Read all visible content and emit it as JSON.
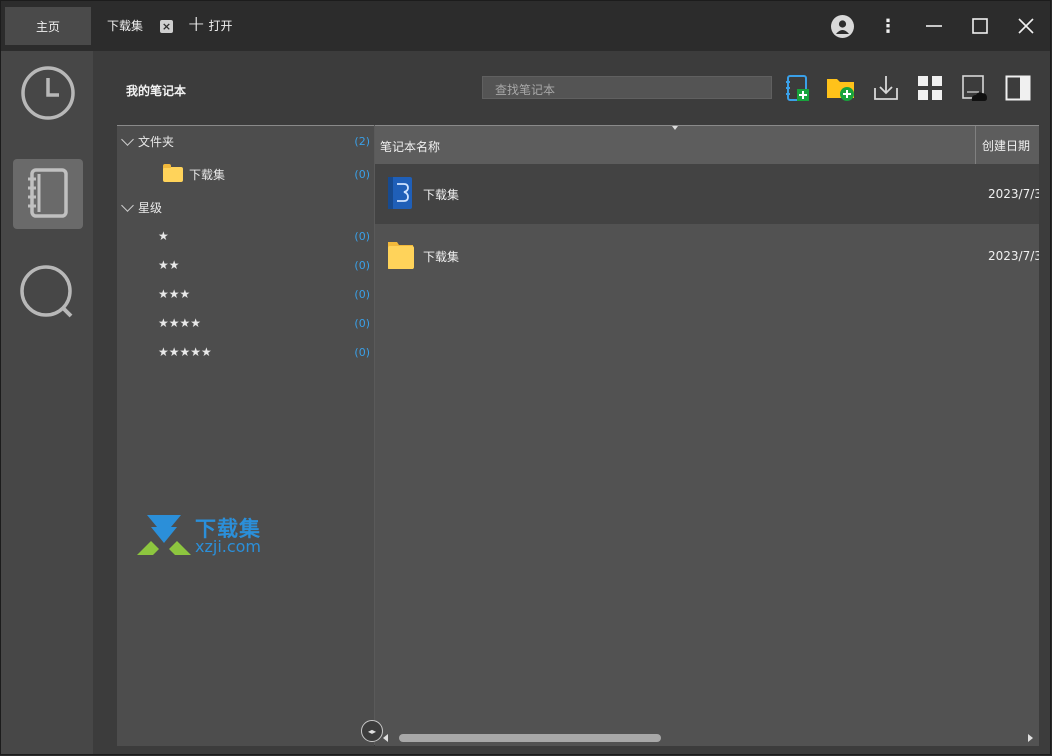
{
  "titlebar": {
    "home_tab": "主页",
    "doc_tab": "下载集",
    "close_tab": "×",
    "open_label": "打开",
    "more": "⋮"
  },
  "main": {
    "title": "我的笔记本",
    "search_placeholder": "查找笔记本"
  },
  "tree": {
    "folders_label": "文件夹",
    "folders_count": "(2)",
    "folder_item": "下载集",
    "folder_item_count": "(0)",
    "stars_label": "星级",
    "stars": [
      {
        "label": "★",
        "count": "(0)"
      },
      {
        "label": "★★",
        "count": "(0)"
      },
      {
        "label": "★★★",
        "count": "(0)"
      },
      {
        "label": "★★★★",
        "count": "(0)"
      },
      {
        "label": "★★★★★",
        "count": "(0)"
      }
    ]
  },
  "list": {
    "col_name": "笔记本名称",
    "col_date": "创建日期",
    "rows": [
      {
        "name": "下载集",
        "date": "2023/7/3",
        "icon": "notebook-icon"
      },
      {
        "name": "下载集",
        "date": "2023/7/3",
        "icon": "folder-icon"
      }
    ]
  },
  "watermark": {
    "text": "下载集",
    "url": "xzji.com"
  },
  "colors": {
    "accent": "#3aa0e8",
    "folder": "#ffd35a",
    "watermark": "#2b8fd9",
    "green_plus": "#18a33c"
  }
}
